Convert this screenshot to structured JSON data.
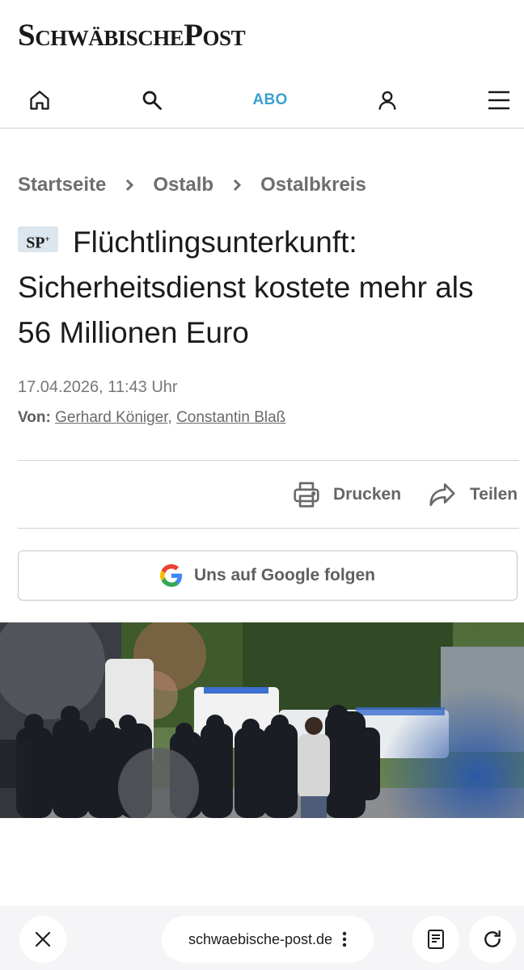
{
  "header": {
    "logo_text": "SchwäbischePost"
  },
  "nav": {
    "home_icon": "home-icon",
    "search_icon": "search-icon",
    "abo_label": "ABO",
    "account_icon": "user-icon",
    "menu_icon": "hamburger-menu-icon",
    "accent_color": "#3aa0cf"
  },
  "breadcrumb": {
    "items": [
      "Startseite",
      "Ostalb",
      "Ostalbkreis"
    ]
  },
  "article": {
    "badge": "SP",
    "badge_sup": "+",
    "title": "Flüchtlingsunterkunft: Sicherheitsdienst kostete mehr als 56 Millionen Euro",
    "date": "17.04.2026, 11:43 Uhr",
    "by_label": "Von:",
    "authors": [
      "Gerhard Königer",
      "Constantin Blaß"
    ],
    "author_separator": ","
  },
  "actions": {
    "print_label": "Drucken",
    "share_label": "Teilen"
  },
  "google_follow": {
    "label": "Uns auf Google folgen"
  },
  "browser_bar": {
    "url": "schwaebische-post.de",
    "close_icon": "close-icon",
    "more_icon": "more-vertical-icon",
    "reader_icon": "reader-icon",
    "reload_icon": "reload-icon"
  }
}
